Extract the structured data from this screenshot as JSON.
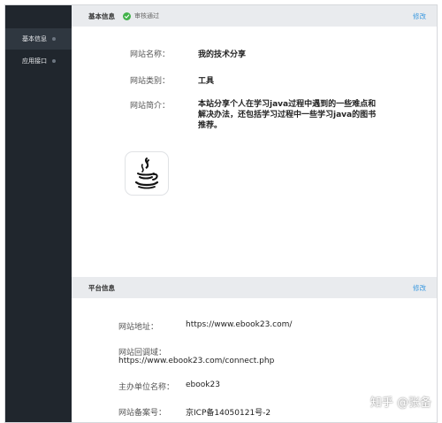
{
  "sidebar": {
    "items": [
      {
        "label": "基本信息",
        "active": true
      },
      {
        "label": "应用接口",
        "active": false
      }
    ]
  },
  "basic": {
    "title": "基本信息",
    "status": "审核通过",
    "edit": "修改",
    "fields": {
      "name_label": "网站名称：",
      "name_value": "我的技术分享",
      "category_label": "网站类别：",
      "category_value": "工具",
      "intro_label": "网站简介：",
      "intro_value": "本站分享个人在学习java过程中遇到的一些难点和解决办法，还包括学习过程中一些学习java的图书推荐。"
    },
    "logo_icon": "java-logo-icon"
  },
  "platform": {
    "title": "平台信息",
    "edit": "修改",
    "fields": {
      "address_label": "网站地址：",
      "address_value": "https://www.ebook23.com/",
      "callback_label": "网站回调域：",
      "callback_value": "https://www.ebook23.com/connect.php",
      "org_label": "主办单位名称：",
      "org_value": "ebook23",
      "icp_label": "网站备案号：",
      "icp_value": "京ICP备14050121号-2"
    }
  },
  "watermark": "知乎 @张备",
  "colors": {
    "sidebar_bg": "#20262d",
    "accent": "#3f9be0",
    "success": "#43b24b",
    "header_bg": "#e9ebee"
  }
}
